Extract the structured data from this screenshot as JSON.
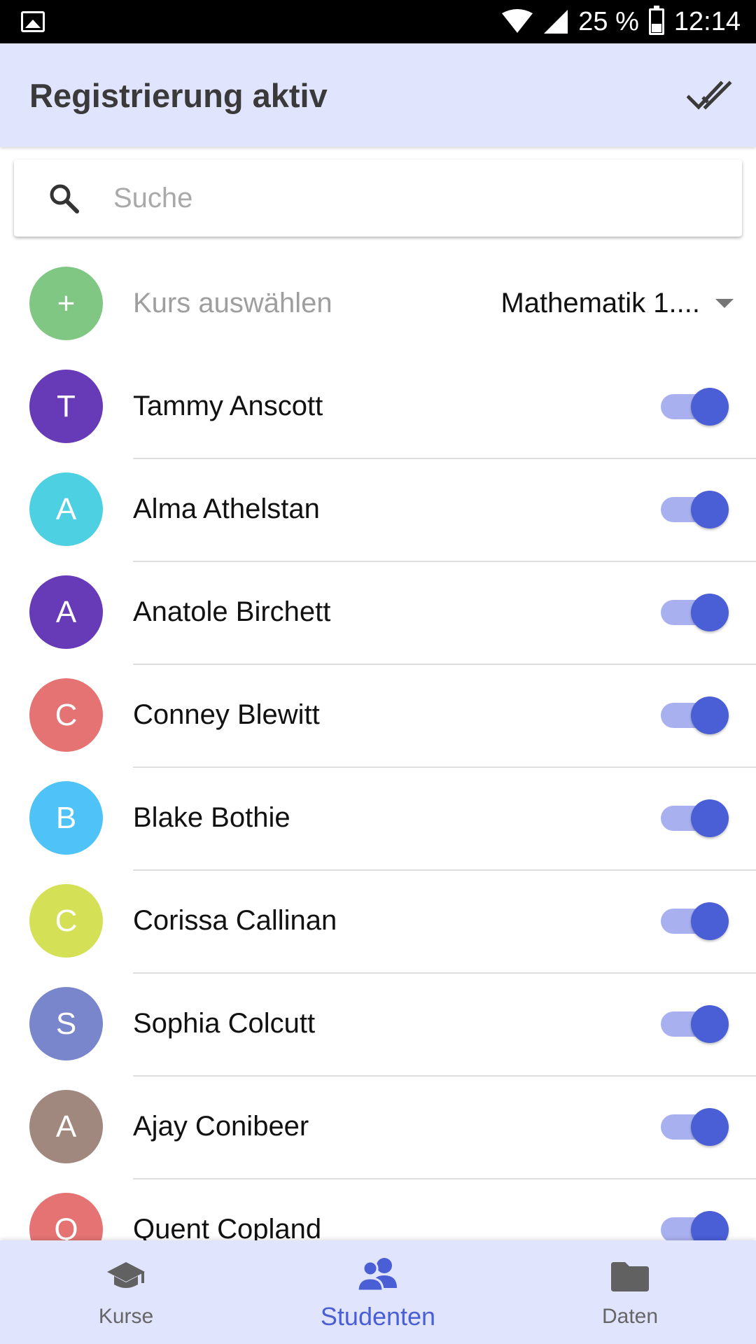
{
  "status_bar": {
    "battery": "25 %",
    "time": "12:14",
    "icons": [
      "image-icon",
      "wifi-icon",
      "signal-icon",
      "battery-icon"
    ]
  },
  "app_bar": {
    "title": "Registrierung aktiv",
    "action_icon": "done-all-icon"
  },
  "search": {
    "placeholder": "Suche",
    "value": ""
  },
  "course_row": {
    "avatar_symbol": "+",
    "avatar_color": "#81c784",
    "label": "Kurs auswählen",
    "selected": "Mathematik 1...."
  },
  "students": [
    {
      "initial": "T",
      "name": "Tammy Anscott",
      "color": "#673ab7",
      "enabled": true
    },
    {
      "initial": "A",
      "name": "Alma Athelstan",
      "color": "#4dd0e1",
      "enabled": true
    },
    {
      "initial": "A",
      "name": "Anatole Birchett",
      "color": "#673ab7",
      "enabled": true
    },
    {
      "initial": "C",
      "name": "Conney Blewitt",
      "color": "#e57373",
      "enabled": true
    },
    {
      "initial": "B",
      "name": "Blake Bothie",
      "color": "#4fc3f7",
      "enabled": true
    },
    {
      "initial": "C",
      "name": "Corissa Callinan",
      "color": "#d4e157",
      "enabled": true
    },
    {
      "initial": "S",
      "name": "Sophia Colcutt",
      "color": "#7986cb",
      "enabled": true
    },
    {
      "initial": "A",
      "name": "Ajay Conibeer",
      "color": "#a1887f",
      "enabled": true
    },
    {
      "initial": "Q",
      "name": "Quent Copland",
      "color": "#e57373",
      "enabled": true
    }
  ],
  "bottom_nav": [
    {
      "label": "Kurse",
      "icon": "school-icon",
      "active": false
    },
    {
      "label": "Studenten",
      "icon": "people-icon",
      "active": true
    },
    {
      "label": "Daten",
      "icon": "folder-icon",
      "active": false
    }
  ],
  "colors": {
    "app_bar_bg": "#e1e4fd",
    "accent": "#4a5ed6",
    "switch_track": "#a8b0ef"
  }
}
